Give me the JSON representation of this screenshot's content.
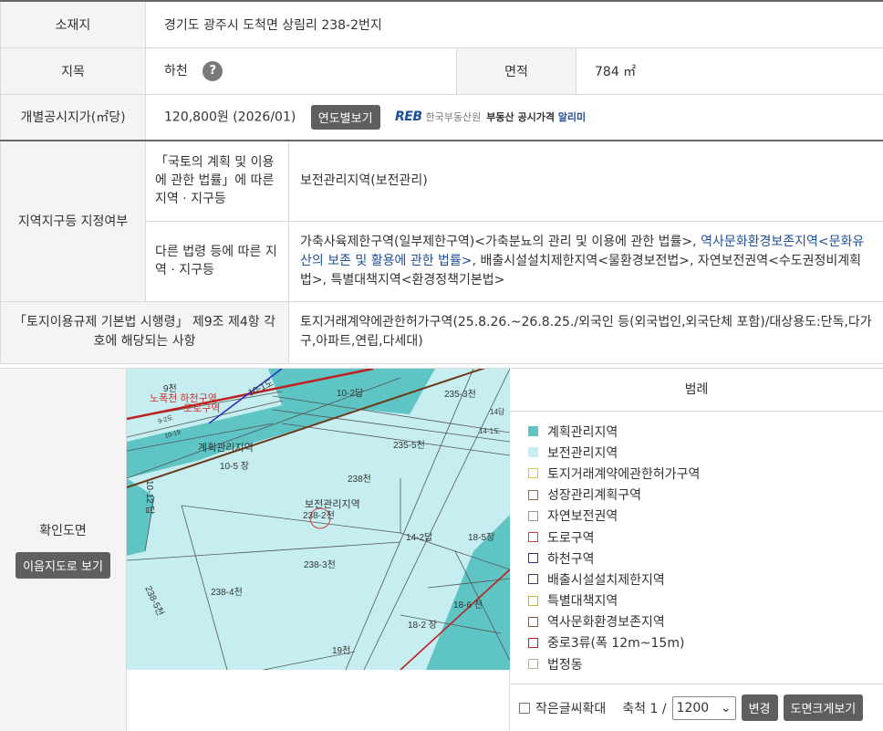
{
  "location": {
    "label": "소재지",
    "value": "경기도 광주시 도척면 상림리 238-2번지"
  },
  "land_category": {
    "label": "지목",
    "value": "하천",
    "help_icon": "question-icon",
    "help_glyph": "?"
  },
  "area": {
    "label": "면적",
    "value": "784 ㎡"
  },
  "price": {
    "label": "개별공시지가(㎡당)",
    "value": "120,800원 (2026/01)",
    "button": "연도별보기",
    "reb_logo": "REB",
    "reb_org": "한국부동산원",
    "reb_service_prefix": "부동산 공시가격",
    "reb_service_hl": "알리미"
  },
  "zones": {
    "label": "지역지구등 지정여부",
    "national": {
      "label": "「국토의 계획 및 이용에 관한 법률」에 따른 지역 · 지구등",
      "value": "보전관리지역(보전관리)"
    },
    "other": {
      "label": "다른 법령 등에 따른 지역 · 지구등",
      "parts": [
        "가축사육제한구역(일부제한구역)<가축분뇨의 관리 및 이용에 관한 법률>, ",
        "역사문화환경보존지역<문화유산의 보존 및 활용에 관한 법률>",
        ", 배출시설설치제한지역<물환경보전법>, 자연보전권역<수도권정비계획법>, 특별대책지역<환경정책기본법>"
      ]
    }
  },
  "regulation": {
    "label": "「토지이용규제 기본법 시행령」 제9조 제4항 각 호에 해당되는 사항",
    "value": "토지거래계약에관한허가구역(25.8.26.~26.8.25./외국인 등(외국법인,외국단체 포함)/대상용도:단독,다가구,아파트,연립,다세대)"
  },
  "confirm": {
    "label": "확인도면",
    "button": "이음지도로 보기"
  },
  "map": {
    "labels": {
      "p9": "9천",
      "p10_1": "10-1도",
      "p10_2": "10-2답",
      "p235_3": "235-3천",
      "p14": "14답",
      "p14_1": "14-1도",
      "p10_19": "10-19",
      "p9_2": "9-2도",
      "road_a": "노폭천 하천구역",
      "road_b": "도로구역",
      "p235_5": "235-5천",
      "plan_zone": "계획관리지역",
      "p10_5": "10-5 장",
      "p238": "238천",
      "p10_12": "10-12 답",
      "cons_zone": "보전관리지역",
      "p238_2": "238-2천",
      "p14_2": "14-2답",
      "p18_5": "18-5장",
      "p238_3": "238-3천",
      "p238_4": "238-4천",
      "p238_5": "238-5천",
      "p18_6": "18-6 천",
      "p18_2": "18-2 장",
      "p19": "19천"
    }
  },
  "legend": {
    "title": "범례",
    "items": [
      {
        "label": "계획관리지역",
        "color": "#5ec4c4",
        "border": "#5ec4c4"
      },
      {
        "label": "보전관리지역",
        "color": "#c6eef0",
        "border": "#c6eef0"
      },
      {
        "label": "토지거래계약에관한허가구역",
        "color": "#ffffff",
        "border": "#e0c040"
      },
      {
        "label": "성장관리계획구역",
        "color": "#ffffff",
        "border": "#8a6a4a"
      },
      {
        "label": "자연보전권역",
        "color": "#ffffff",
        "border": "#999999"
      },
      {
        "label": "도로구역",
        "color": "#ffffff",
        "border": "#d04040"
      },
      {
        "label": "하천구역",
        "color": "#ffffff",
        "border": "#303080"
      },
      {
        "label": "배출시설설치제한지역",
        "color": "#ffffff",
        "border": "#404070"
      },
      {
        "label": "특별대책지역",
        "color": "#ffffff",
        "border": "#c8b820"
      },
      {
        "label": "역사문화환경보존지역",
        "color": "#ffffff",
        "border": "#8a5a3a"
      },
      {
        "label": "중로3류(폭 12m~15m)",
        "color": "#ffffff",
        "border": "#c02020"
      },
      {
        "label": "법정동",
        "color": "#ffffff",
        "border": "#b0b090"
      }
    ],
    "small_text": "작은글씨확대",
    "scale_label": "축척 1 /",
    "scale_value": "1200",
    "apply_button": "변경",
    "print_button": "도면크게보기"
  }
}
